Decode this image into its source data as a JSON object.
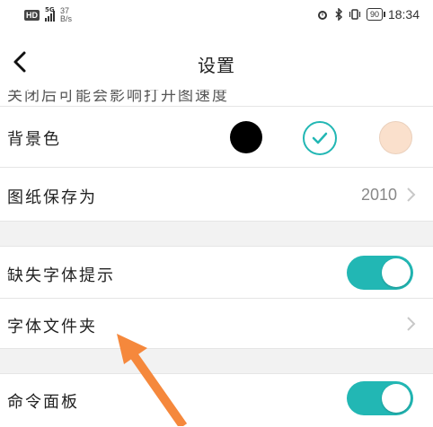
{
  "status_bar": {
    "hd_badge": "HD",
    "network": "5G",
    "speed_value": "37",
    "speed_unit": "B/s",
    "battery": "90",
    "time": "18:34"
  },
  "header": {
    "title": "设置"
  },
  "partial_row": {
    "text": "关闭后可能会影响打开图速度"
  },
  "settings": {
    "background_color": {
      "label": "背景色",
      "options": [
        "#000000",
        "#ffffff",
        "#fae0cc"
      ],
      "selected_index": 1,
      "selected_color": "#22b7b4"
    },
    "save_drawing_as": {
      "label": "图纸保存为",
      "value": "2010"
    },
    "missing_font_prompt": {
      "label": "缺失字体提示",
      "enabled": true
    },
    "font_folder": {
      "label": "字体文件夹"
    },
    "command_panel": {
      "label": "命令面板",
      "enabled": true
    }
  },
  "colors": {
    "accent": "#22b7b4",
    "annotation_arrow": "#f5883c",
    "section_gap": "#f2f2f2"
  }
}
